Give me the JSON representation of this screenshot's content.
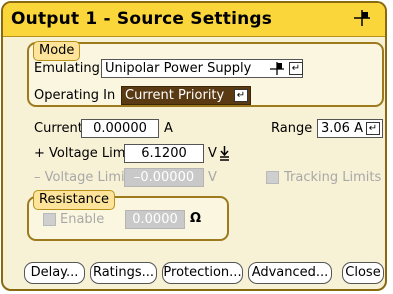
{
  "title": "Output 1 - Source Settings",
  "mode": {
    "label": "Mode",
    "emulating_label": "Emulating",
    "emulating_value": "Unipolar Power Supply",
    "operating_label": "Operating In",
    "operating_value": "Current Priority"
  },
  "current": {
    "label": "Current",
    "value": "0.00000",
    "unit": "A"
  },
  "range": {
    "label": "Range",
    "value": "3.06 A"
  },
  "plus_voltage": {
    "label": "+ Voltage Limit",
    "value": "6.1200",
    "unit": "V"
  },
  "minus_voltage": {
    "label": "– Voltage Limit",
    "value": "–0.00000",
    "unit": "V"
  },
  "tracking": {
    "label": "Tracking Limits"
  },
  "resistance": {
    "label": "Resistance",
    "enable_label": "Enable",
    "value": "0.0000",
    "unit": "Ω"
  },
  "buttons": {
    "delay": "Delay...",
    "ratings": "Ratings...",
    "protection": "Protection...",
    "advanced": "Advanced...",
    "close": "Close"
  },
  "icons": {
    "enter": "enter-key-icon",
    "quadrant": "quadrant-icon",
    "sense": "sense-terminal-icon"
  },
  "colors": {
    "title_bar": "#fbd63b",
    "panel": "#f7f1d6",
    "border": "#8a6a10",
    "selected_field": "#5a3a12"
  }
}
